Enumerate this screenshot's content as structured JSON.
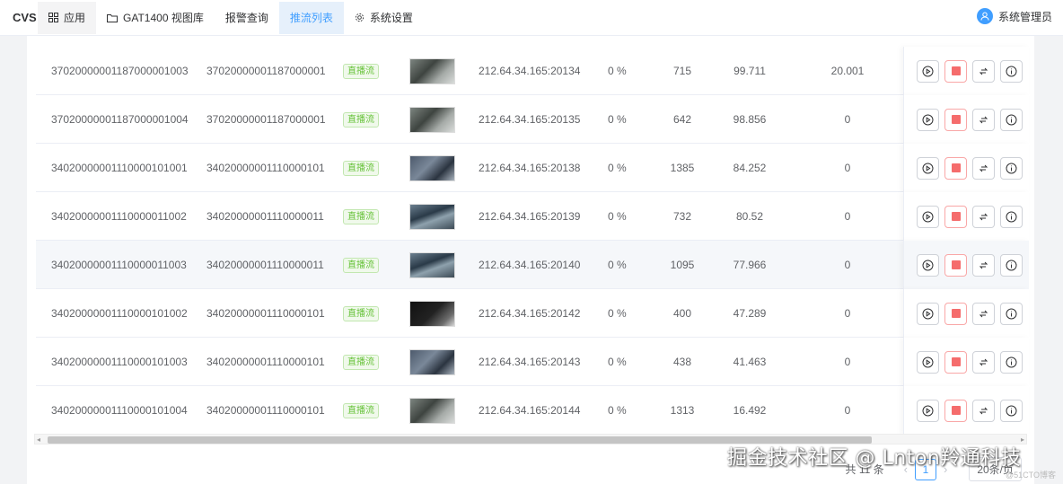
{
  "app": {
    "brand": "CVS"
  },
  "nav": [
    {
      "label": "应用",
      "icon": "grid-icon",
      "state": "muted"
    },
    {
      "label": "GAT1400 视图库",
      "icon": "folder-icon",
      "state": ""
    },
    {
      "label": "报警查询",
      "icon": "",
      "state": ""
    },
    {
      "label": "推流列表",
      "icon": "",
      "state": "active"
    },
    {
      "label": "系统设置",
      "icon": "gear-icon",
      "state": ""
    }
  ],
  "user": {
    "name": "系统管理员"
  },
  "rows": [
    {
      "id": "37020000001187000001003",
      "parent": "37020000001187000001",
      "tag": "直播流",
      "addr": "212.64.34.165:20134",
      "pct": "0 %",
      "n1": "715",
      "n2": "99.711",
      "n3": "20.001",
      "thumb": ""
    },
    {
      "id": "37020000001187000001004",
      "parent": "37020000001187000001",
      "tag": "直播流",
      "addr": "212.64.34.165:20135",
      "pct": "0 %",
      "n1": "642",
      "n2": "98.856",
      "n3": "0",
      "thumb": ""
    },
    {
      "id": "34020000001110000101001",
      "parent": "34020000001110000101",
      "tag": "直播流",
      "addr": "212.64.34.165:20138",
      "pct": "0 %",
      "n1": "1385",
      "n2": "84.252",
      "n3": "0",
      "thumb": "blue"
    },
    {
      "id": "34020000001110000011002",
      "parent": "34020000001110000011",
      "tag": "直播流",
      "addr": "212.64.34.165:20139",
      "pct": "0 %",
      "n1": "732",
      "n2": "80.52",
      "n3": "0",
      "thumb": "city"
    },
    {
      "id": "34020000001110000011003",
      "parent": "34020000001110000011",
      "tag": "直播流",
      "addr": "212.64.34.165:20140",
      "pct": "0 %",
      "n1": "1095",
      "n2": "77.966",
      "n3": "0",
      "thumb": "city"
    },
    {
      "id": "34020000001110000101002",
      "parent": "34020000001110000101",
      "tag": "直播流",
      "addr": "212.64.34.165:20142",
      "pct": "0 %",
      "n1": "400",
      "n2": "47.289",
      "n3": "0",
      "thumb": "dark"
    },
    {
      "id": "34020000001110000101003",
      "parent": "34020000001110000101",
      "tag": "直播流",
      "addr": "212.64.34.165:20143",
      "pct": "0 %",
      "n1": "438",
      "n2": "41.463",
      "n3": "0",
      "thumb": "blue"
    },
    {
      "id": "34020000001110000101004",
      "parent": "34020000001110000101",
      "tag": "直播流",
      "addr": "212.64.34.165:20144",
      "pct": "0 %",
      "n1": "1313",
      "n2": "16.492",
      "n3": "0",
      "thumb": ""
    }
  ],
  "pager": {
    "total": "共 11 条",
    "page": "1",
    "size": "20条/页",
    "prev": "‹",
    "next": "›"
  },
  "watermark": {
    "text": "掘金技术社区 @ Lnton羚通科技",
    "small": "@51CTO博客"
  }
}
